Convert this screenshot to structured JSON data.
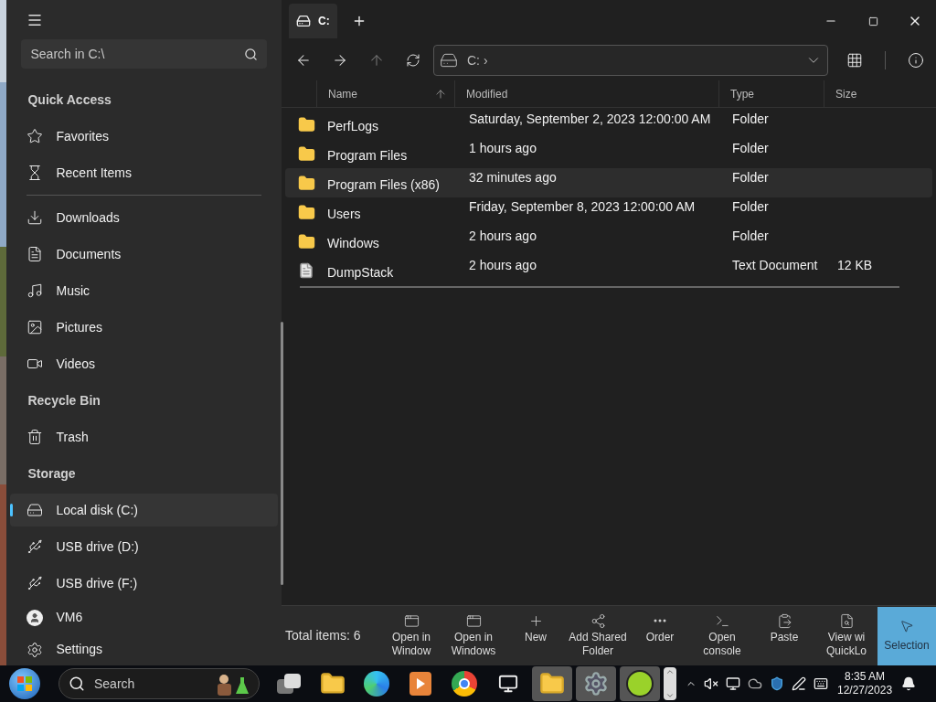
{
  "tabs": [
    {
      "label": "C:",
      "selected": true
    }
  ],
  "address": {
    "path": "C: ›"
  },
  "sidebar": {
    "search": {
      "placeholder": "Search in C:\\"
    },
    "sections": [
      {
        "title": "Quick Access",
        "items": [
          {
            "label": "Favorites",
            "selected": false
          },
          {
            "label": "Recent Items",
            "selected": false
          },
          {
            "kind": "divider"
          },
          {
            "label": "Downloads",
            "selected": false
          },
          {
            "label": "Documents",
            "selected": false
          },
          {
            "label": "Music",
            "selected": false
          },
          {
            "label": "Pictures",
            "selected": false
          },
          {
            "label": "Videos",
            "selected": false
          }
        ]
      },
      {
        "title": "Recycle Bin",
        "items": [
          {
            "label": "Trash",
            "selected": false
          }
        ]
      },
      {
        "title": "Storage",
        "items": [
          {
            "label": "Local disk (C:)",
            "selected": true
          },
          {
            "label": "USB drive (D:)",
            "selected": false
          },
          {
            "label": "USB drive (F:)",
            "selected": false
          }
        ]
      }
    ],
    "footer": [
      {
        "label": "VM6"
      },
      {
        "label": "Settings"
      }
    ]
  },
  "table": {
    "columns": [
      "Name",
      "Modified",
      "Type",
      "Size"
    ],
    "rows": [
      {
        "kind": "folder",
        "name": "PerfLogs",
        "modified": "Saturday, September 2, 2023 12:00:00 AM",
        "type": "Folder",
        "selected": false
      },
      {
        "kind": "folder",
        "name": "Program Files",
        "modified": "1 hours ago",
        "type": "Folder",
        "selected": false
      },
      {
        "kind": "folder",
        "name": "Program Files (x86)",
        "modified": "32 minutes ago",
        "type": "Folder",
        "selected": true
      },
      {
        "kind": "folder",
        "name": "Users",
        "modified": "Friday, September 8, 2023 12:00:00 AM",
        "type": "Folder",
        "selected": false
      },
      {
        "kind": "folder",
        "name": "Windows",
        "modified": "2 hours ago",
        "type": "Folder",
        "selected": false
      },
      {
        "kind": "file",
        "name": "DumpStack",
        "modified": "2 hours ago",
        "type": "Text Document",
        "size": "12 KB",
        "selected": false
      }
    ]
  },
  "status": {
    "total": "Total items: 6"
  },
  "commands": [
    {
      "label": "Open in Window"
    },
    {
      "label": "Open in Windows"
    },
    {
      "label": "New"
    },
    {
      "label": "Add Shared Folder"
    },
    {
      "label": "Order"
    },
    {
      "label": "Open console"
    },
    {
      "label": "Paste"
    },
    {
      "label": "View wi QuickLo"
    }
  ],
  "selection_button": {
    "label": "Selection",
    "on": true
  },
  "taskbar": {
    "search": {
      "placeholder": "Search"
    },
    "time": "8:35 AM",
    "date": "12/27/2023"
  }
}
